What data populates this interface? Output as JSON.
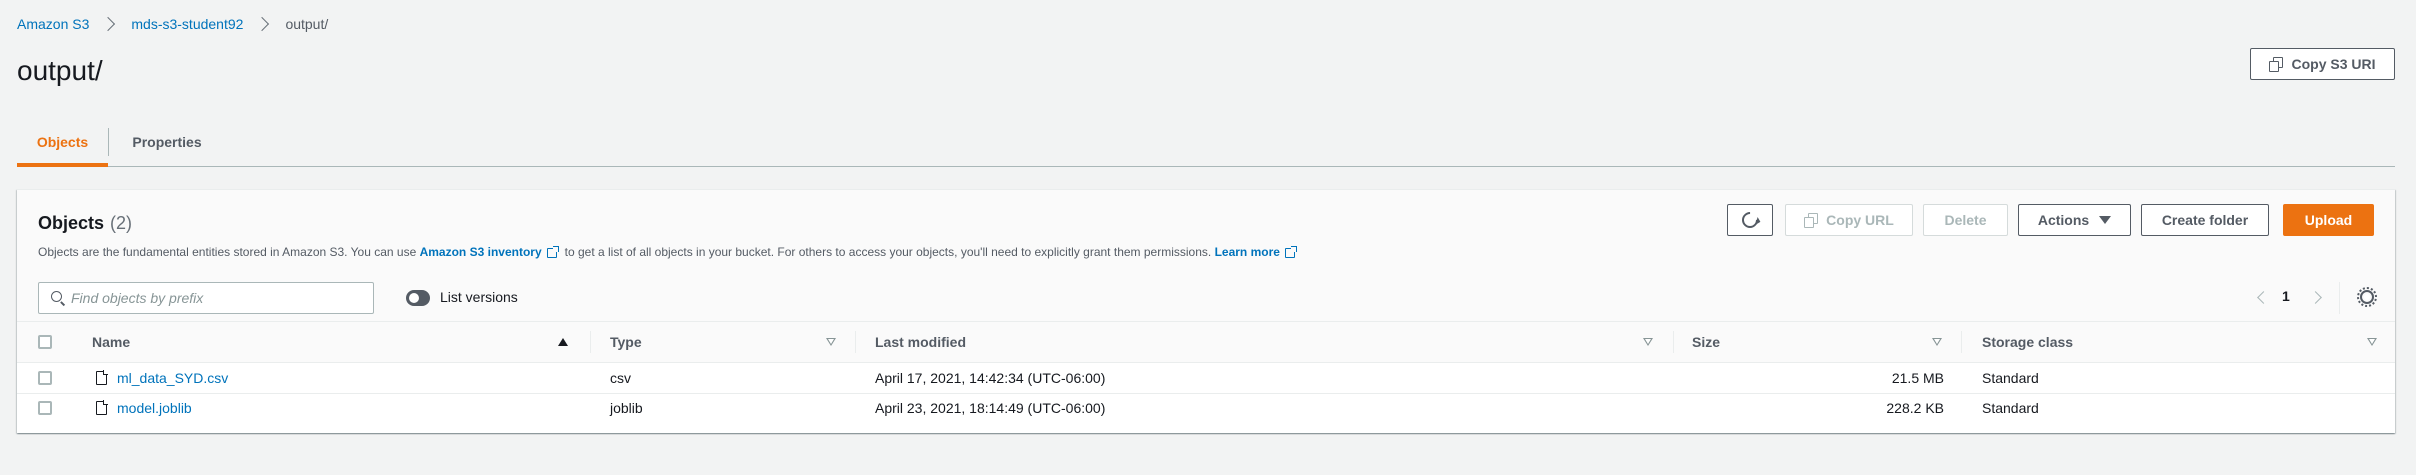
{
  "breadcrumb": {
    "items": [
      "Amazon S3",
      "mds-s3-student92"
    ],
    "current": "output/"
  },
  "page": {
    "title": "output/",
    "copy_s3_uri_label": "Copy S3 URI"
  },
  "tabs": [
    {
      "label": "Objects",
      "active": true
    },
    {
      "label": "Properties",
      "active": false
    }
  ],
  "objects": {
    "title": "Objects",
    "count": "(2)",
    "description_pre": "Objects are the fundamental entities stored in Amazon S3. You can use",
    "inventory_link": "Amazon S3 inventory",
    "description_mid": "to get a list of all objects in your bucket. For others to access your objects, you'll need to explicitly grant them permissions.",
    "learn_more": "Learn more",
    "buttons": {
      "refresh_icon": "refresh-icon",
      "copy_url": "Copy URL",
      "delete": "Delete",
      "actions": "Actions",
      "create_folder": "Create folder",
      "upload": "Upload"
    },
    "search_placeholder": "Find objects by prefix",
    "list_versions_label": "List versions",
    "list_versions_on": false,
    "pagination": {
      "current_page": "1"
    },
    "columns": [
      "Name",
      "Type",
      "Last modified",
      "Size",
      "Storage class"
    ],
    "rows": [
      {
        "name": "ml_data_SYD.csv",
        "type": "csv",
        "last_modified": "April 17, 2021, 14:42:34 (UTC-06:00)",
        "size": "21.5 MB",
        "storage_class": "Standard"
      },
      {
        "name": "model.joblib",
        "type": "joblib",
        "last_modified": "April 23, 2021, 18:14:49 (UTC-06:00)",
        "size": "228.2 KB",
        "storage_class": "Standard"
      }
    ]
  },
  "colors": {
    "accent": "#ec7211",
    "link": "#0073bb",
    "background": "#f2f3f3"
  }
}
